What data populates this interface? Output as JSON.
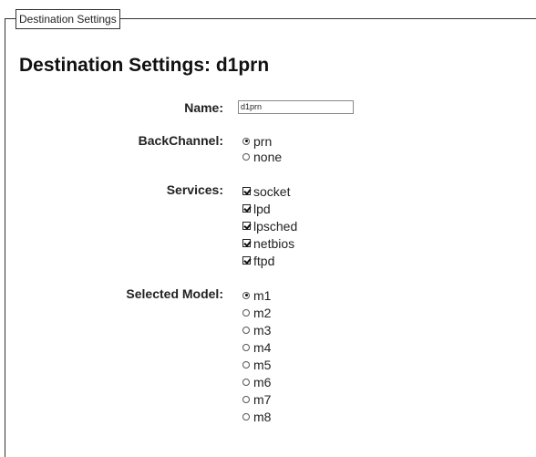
{
  "fieldset": {
    "legend": "Destination Settings"
  },
  "page": {
    "title": "Destination Settings: d1prn"
  },
  "form": {
    "name": {
      "label": "Name:",
      "value": "d1prn"
    },
    "backchannel": {
      "label": "BackChannel:",
      "options": [
        {
          "label": "prn",
          "checked": true
        },
        {
          "label": "none",
          "checked": false
        }
      ]
    },
    "services": {
      "label": "Services:",
      "options": [
        {
          "label": "socket",
          "checked": true
        },
        {
          "label": "lpd",
          "checked": true
        },
        {
          "label": "lpsched",
          "checked": true
        },
        {
          "label": "netbios",
          "checked": true
        },
        {
          "label": "ftpd",
          "checked": true
        }
      ]
    },
    "selected_model": {
      "label": "Selected Model:",
      "options": [
        {
          "label": "m1",
          "checked": true
        },
        {
          "label": "m2",
          "checked": false
        },
        {
          "label": "m3",
          "checked": false
        },
        {
          "label": "m4",
          "checked": false
        },
        {
          "label": "m5",
          "checked": false
        },
        {
          "label": "m6",
          "checked": false
        },
        {
          "label": "m7",
          "checked": false
        },
        {
          "label": "m8",
          "checked": false
        }
      ]
    }
  }
}
